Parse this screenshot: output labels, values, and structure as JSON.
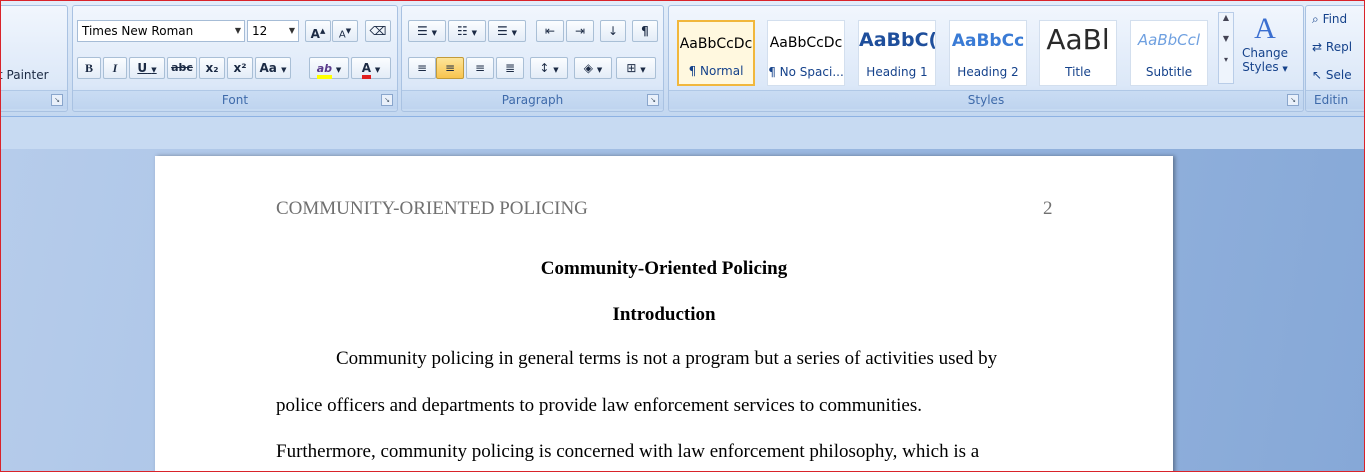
{
  "clipboard": {
    "format_painter_label": "t Painter"
  },
  "font": {
    "group_label": "Font",
    "font_name": "Times New Roman",
    "font_size": "12",
    "bold": "B",
    "italic": "I",
    "underline": "U",
    "strike": "abc",
    "subscript": "x₂",
    "superscript": "x²",
    "change_case": "Aa",
    "highlight": "ab",
    "font_color": "A"
  },
  "paragraph": {
    "group_label": "Paragraph",
    "show_marks": "¶"
  },
  "styles": {
    "group_label": "Styles",
    "tiles": [
      {
        "sample": "AaBbCcDc",
        "name": "¶ Normal"
      },
      {
        "sample": "AaBbCcDc",
        "name": "¶ No Spaci..."
      },
      {
        "sample": "AaBbC(",
        "name": "Heading 1"
      },
      {
        "sample": "AaBbCc",
        "name": "Heading 2"
      },
      {
        "sample": "AaBl",
        "name": "Title"
      },
      {
        "sample": "AaBbCcl",
        "name": "Subtitle"
      }
    ],
    "change_styles_line1": "Change",
    "change_styles_line2": "Styles"
  },
  "editing": {
    "group_label": "Editin",
    "find": "Find",
    "replace": "Repl",
    "select": "Sele"
  },
  "document": {
    "running_head": "COMMUNITY-ORIENTED POLICING",
    "page_number": "2",
    "title": "Community-Oriented Policing",
    "heading": "Introduction",
    "lines": [
      "Community policing in general terms is not a program but a series of activities used by",
      "police officers and departments to provide law enforcement services to communities.",
      "Furthermore, community policing is concerned with law enforcement philosophy, which is a"
    ]
  },
  "colors": {
    "accent_border": "#d9232a",
    "selected_style": "#f1b73c",
    "ribbon_text": "#15428b"
  }
}
